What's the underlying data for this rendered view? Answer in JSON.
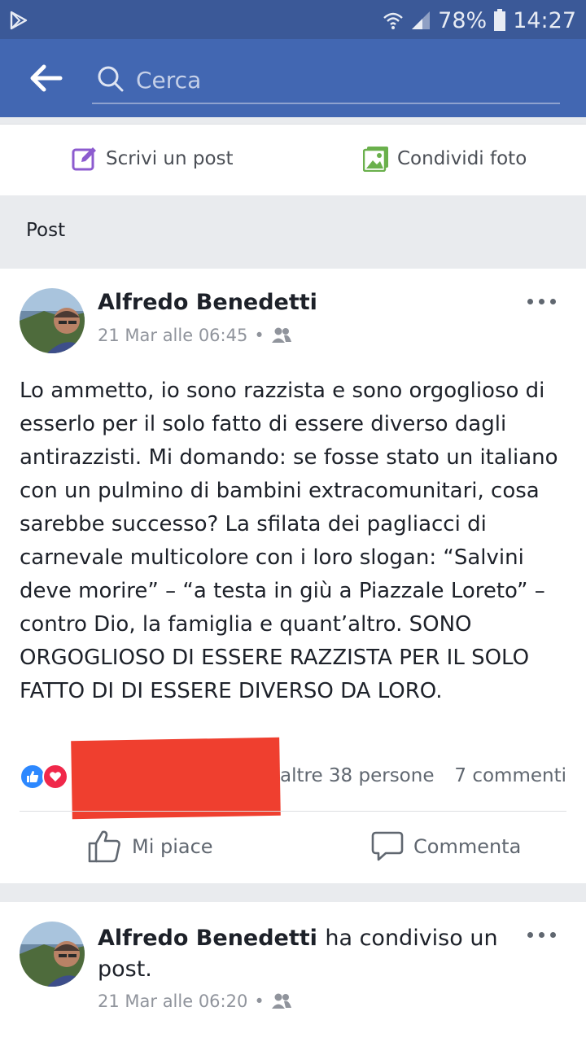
{
  "status_bar": {
    "battery": "78%",
    "time": "14:27"
  },
  "search": {
    "placeholder": "Cerca"
  },
  "composer": {
    "write_post": "Scrivi un post",
    "share_photo": "Condividi foto"
  },
  "section_title": "Post",
  "posts": [
    {
      "author": "Alfredo Benedetti",
      "timestamp": "21 Mar alle 06:45",
      "body": "Lo ammetto, io sono razzista e sono orgoglioso di esserlo per il solo fatto di essere diverso dagli antirazzisti. Mi domando: se fosse stato un italiano con un pulmino di bambini extracomunitari, cosa sarebbe successo? La sfilata dei pagliacci di carnevale multicolore con i loro slogan: “Salvini deve morire” – “a testa in giù a Piazzale Loreto” – contro Dio, la famiglia e quant’altro. SONO ORGOGLIOSO DI ESSERE RAZZISTA PER IL SOLO FATTO DI DI ESSERE DIVERSO DA LORO.",
      "reactions_text": "altre 38 persone",
      "comments_text": "7 commenti",
      "like_label": "Mi piace",
      "comment_label": "Commenta"
    },
    {
      "author": "Alfredo Benedetti",
      "shared_text": "ha condiviso un post.",
      "timestamp": "21 Mar alle 06:20"
    }
  ],
  "colors": {
    "header": "#4267b2",
    "status": "#3b5998",
    "like_blue": "#2d88ff",
    "love_red": "#f0284a",
    "redaction": "#ef3f2f"
  },
  "icons": [
    "play-store-icon",
    "wifi-icon",
    "signal-icon",
    "battery-icon",
    "back-arrow-icon",
    "search-icon",
    "edit-icon",
    "photo-icon",
    "friends-icon",
    "more-icon",
    "like-reaction-icon",
    "love-reaction-icon",
    "thumbs-up-icon",
    "comment-icon"
  ]
}
